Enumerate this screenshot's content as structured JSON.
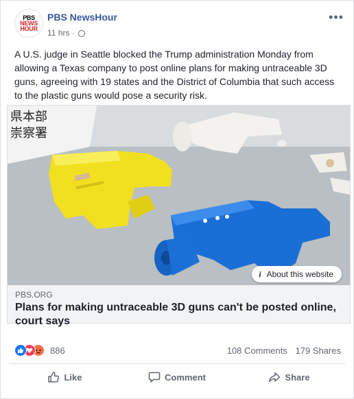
{
  "post": {
    "page_name": "PBS NewsHour",
    "time": "11 hrs",
    "separator": "·",
    "text": "A U.S. judge in Seattle blocked the Trump administration Monday from allowing a Texas company to post online plans for making untraceable 3D guns, agreeing with 19 states and the District of Columbia that such access to the plastic guns would pose a security risk.",
    "more": "•••"
  },
  "logo": {
    "line1": "PBS",
    "line2": "NEWS",
    "line3": "HOUR"
  },
  "image_sign": {
    "l1": "県本部",
    "l2": "崇察署"
  },
  "link": {
    "domain": "PBS.ORG",
    "title": "Plans for making untraceable 3D guns can't be posted online, court says",
    "about_icon": "i",
    "about_label": "About this website"
  },
  "stats": {
    "reaction_count": "886",
    "comments": "108 Comments",
    "shares": "179 Shares"
  },
  "actions": {
    "like": "Like",
    "comment": "Comment",
    "share": "Share"
  },
  "colors": {
    "link_blue": "#365899",
    "like_blue": "#1877f2",
    "love_red": "#f33e58",
    "angry_orange": "#f7714b"
  }
}
